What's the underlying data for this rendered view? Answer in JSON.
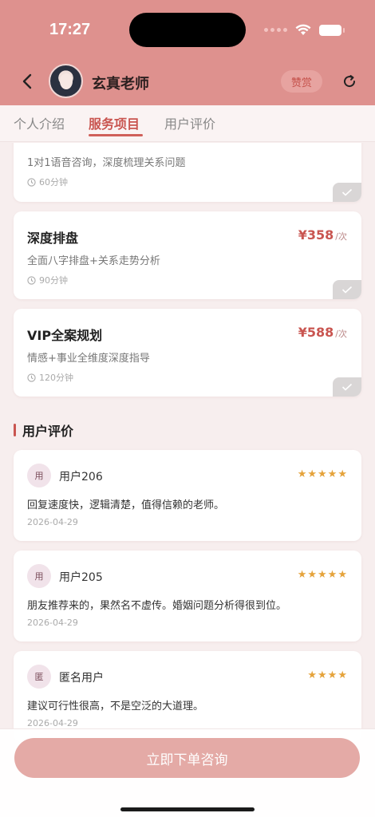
{
  "status_bar": {
    "time": "17:27"
  },
  "header": {
    "teacher_name": "玄真老师",
    "tip_label": "赞赏",
    "colors": {
      "background": "#de918e",
      "accent": "#c95550"
    }
  },
  "tabs": [
    {
      "label": "个人介绍",
      "active": false
    },
    {
      "label": "服务项目",
      "active": true
    },
    {
      "label": "用户评价",
      "active": false
    }
  ],
  "services": [
    {
      "title": "",
      "price": "",
      "unit": "",
      "desc": "1对1语音咨询，深度梳理关系问题",
      "duration": "60分钟"
    },
    {
      "title": "深度排盘",
      "price": "¥358",
      "unit": "/次",
      "desc": "全面八字排盘+关系走势分析",
      "duration": "90分钟"
    },
    {
      "title": "VIP全案规划",
      "price": "¥588",
      "unit": "/次",
      "desc": "情感+事业全维度深度指导",
      "duration": "120分钟"
    }
  ],
  "reviews_section": {
    "title": "用户评价"
  },
  "reviews": [
    {
      "avatar": "用",
      "user": "用户206",
      "stars": "★★★★★",
      "text": "回复速度快，逻辑清楚，值得信赖的老师。",
      "date": "2026-04-29"
    },
    {
      "avatar": "用",
      "user": "用户205",
      "stars": "★★★★★",
      "text": "朋友推荐来的，果然名不虚传。婚姻问题分析得很到位。",
      "date": "2026-04-29"
    },
    {
      "avatar": "匿",
      "user": "匿名用户",
      "stars": "★★★★",
      "text": "建议可行性很高，不是空泛的大道理。",
      "date": "2026-04-29"
    }
  ],
  "bottom": {
    "order_label": "立即下单咨询"
  }
}
